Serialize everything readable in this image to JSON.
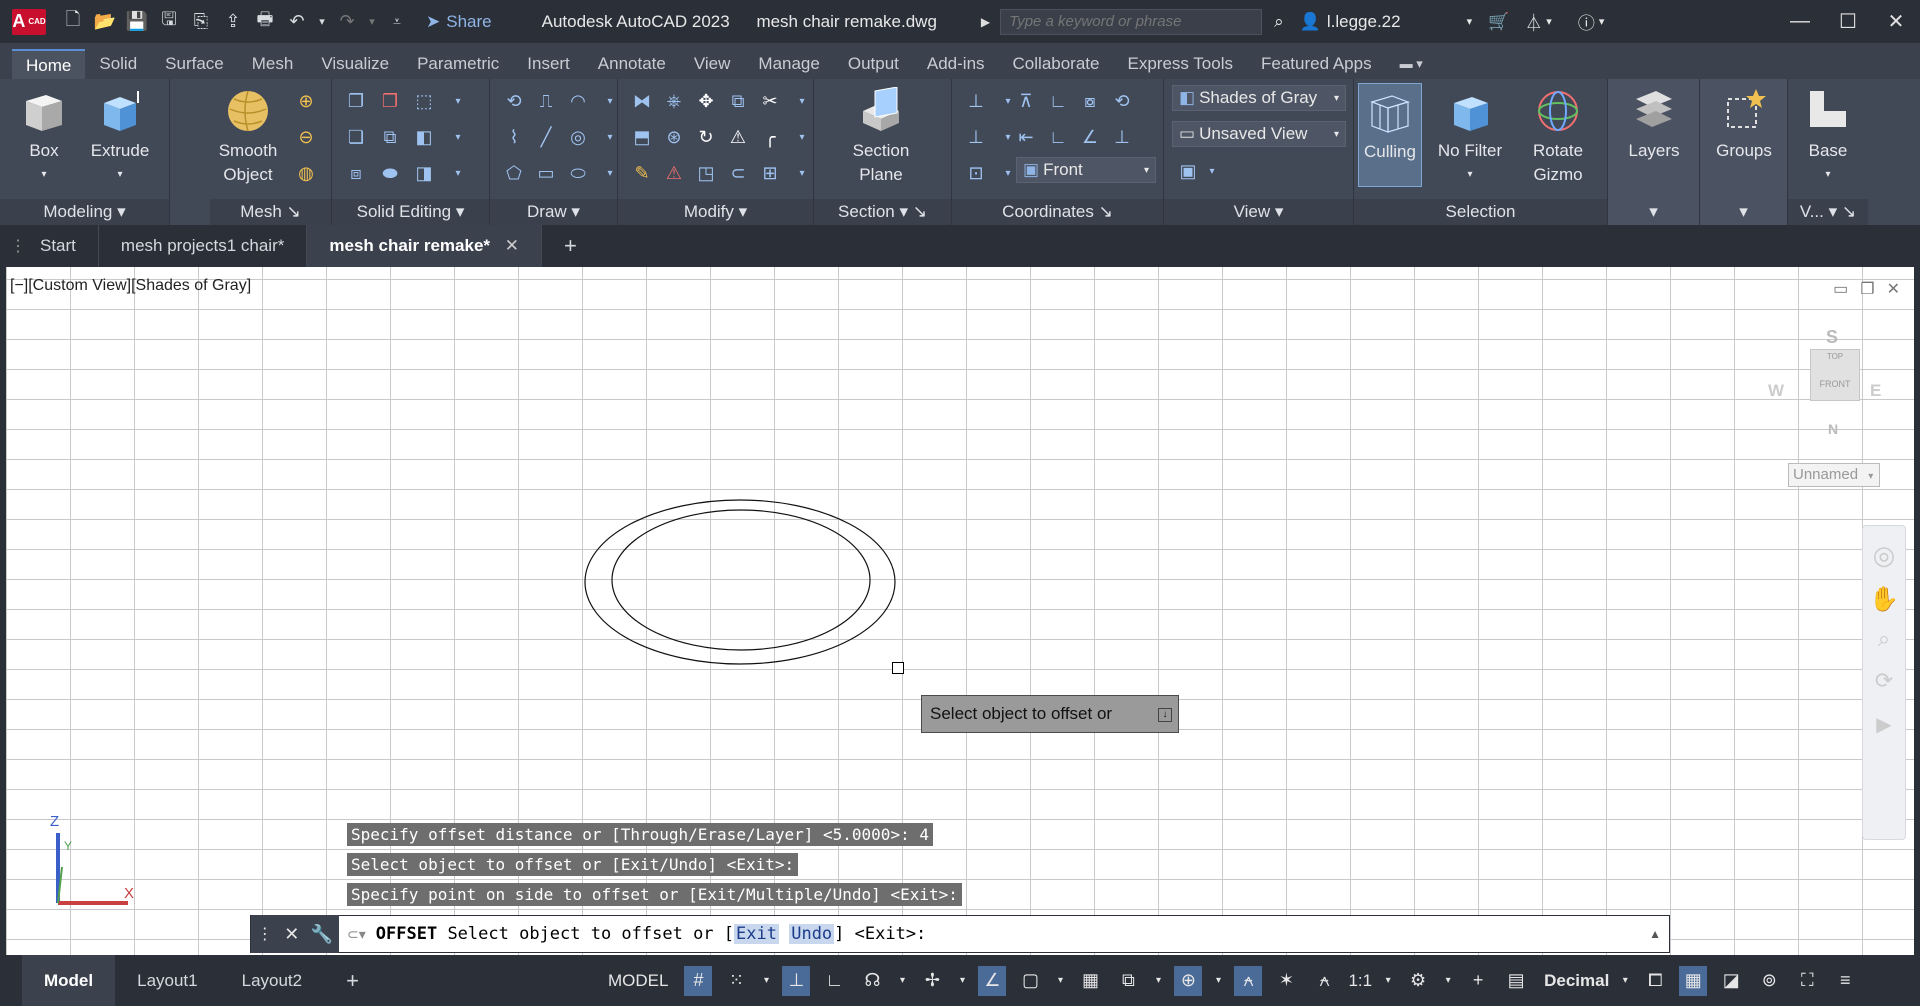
{
  "titlebar": {
    "logo_text": "A",
    "logo_sub": "CAD",
    "share_label": "Share",
    "app_title": "Autodesk AutoCAD 2023",
    "file_title": "mesh chair remake.dwg",
    "search_placeholder": "Type a keyword or phrase",
    "user": "l.legge.22"
  },
  "ribbon_tabs": [
    "Home",
    "Solid",
    "Surface",
    "Mesh",
    "Visualize",
    "Parametric",
    "Insert",
    "Annotate",
    "View",
    "Manage",
    "Output",
    "Add-ins",
    "Collaborate",
    "Express Tools",
    "Featured Apps"
  ],
  "ribbon": {
    "modeling": {
      "title": "Modeling",
      "box": "Box",
      "extrude": "Extrude"
    },
    "mesh": {
      "title": "Mesh",
      "smooth": "Smooth\nObject"
    },
    "solid_editing": {
      "title": "Solid Editing"
    },
    "draw": {
      "title": "Draw"
    },
    "modify": {
      "title": "Modify"
    },
    "section": {
      "title": "Section",
      "plane": "Section\nPlane"
    },
    "coordinates": {
      "title": "Coordinates",
      "front": "Front"
    },
    "view": {
      "title": "View",
      "visual_style": "Shades of Gray",
      "saved_view": "Unsaved View"
    },
    "selection": {
      "title": "Selection",
      "culling": "Culling",
      "no_filter": "No Filter",
      "rotate_gizmo": "Rotate\nGizmo"
    },
    "layers": {
      "label": "Layers"
    },
    "groups": {
      "label": "Groups"
    },
    "base": {
      "label": "Base",
      "title": "V..."
    }
  },
  "file_tabs": [
    "Start",
    "mesh projects1 chair*",
    "mesh chair remake*"
  ],
  "viewport": {
    "label": "[−][Custom View][Shades of Gray]",
    "viewcube": {
      "top": "TOP",
      "front": "FRONT",
      "n": "N",
      "s": "S",
      "w": "W",
      "e": "E"
    },
    "named_view": "Unnamed",
    "tooltip": "Select object to offset or",
    "ucs": {
      "z": "Z",
      "x": "X",
      "y": "Y"
    }
  },
  "command_history": [
    "Specify offset distance or [Through/Erase/Layer] <5.0000>: 4",
    "Select object to offset or [Exit/Undo] <Exit>:",
    "Specify point on side to offset or [Exit/Multiple/Undo] <Exit>:"
  ],
  "command_line": {
    "command": "OFFSET",
    "prompt": "Select object to offset or [",
    "opt1": "Exit",
    "opt2": "Undo",
    "suffix": "] <Exit>:"
  },
  "status": {
    "layouts": [
      "Model",
      "Layout1",
      "Layout2"
    ],
    "model": "MODEL",
    "scale": "1:1",
    "units": "Decimal"
  },
  "colors": {
    "accent": "#5a8fd6",
    "canvas": "#ffffff",
    "ui_dark": "#2b2f38",
    "ribbon": "#414856"
  }
}
